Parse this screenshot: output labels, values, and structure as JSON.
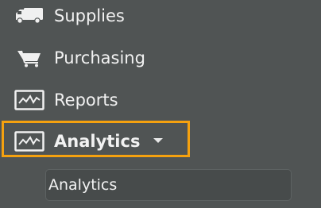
{
  "menu": {
    "items": [
      {
        "label": "Supplies",
        "icon": "truck-icon"
      },
      {
        "label": "Purchasing",
        "icon": "cart-icon"
      },
      {
        "label": "Reports",
        "icon": "chart-icon"
      },
      {
        "label": "Analytics",
        "icon": "chart-icon"
      }
    ],
    "submenu": [
      {
        "label": "Analytics"
      }
    ]
  },
  "colors": {
    "background": "#505454",
    "text": "#f2f2f2",
    "highlight": "#f5a10f"
  }
}
